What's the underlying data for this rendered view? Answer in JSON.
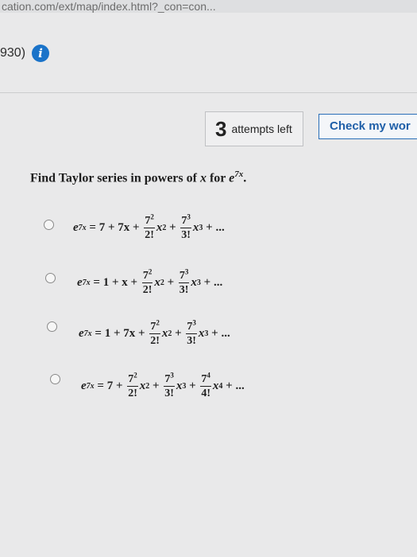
{
  "browser": {
    "url": "cation.com/ext/map/index.html?_con=con..."
  },
  "header": {
    "partial_text": "930)",
    "info_icon": "info-icon"
  },
  "toolbar": {
    "attempts_count": "3",
    "attempts_label": "attempts left",
    "check_label": "Check my wor"
  },
  "question": {
    "prefix": "Find Taylor series in powers of ",
    "var": "x",
    "mid": " for ",
    "base": "e",
    "exponent": "7x",
    "suffix": "."
  },
  "options": [
    {
      "lhs": "e",
      "lhs_exp": "7x",
      "eq": " = 7 + 7x + ",
      "terms": [
        {
          "num": "7",
          "num_exp": "2",
          "den": "2!",
          "x_exp": "2"
        },
        {
          "num": "7",
          "num_exp": "3",
          "den": "3!",
          "x_exp": "3"
        }
      ],
      "tail": " + ..."
    },
    {
      "lhs": "e",
      "lhs_exp": "7x",
      "eq": " = 1 + x + ",
      "terms": [
        {
          "num": "7",
          "num_exp": "2",
          "den": "2!",
          "x_exp": "2"
        },
        {
          "num": "7",
          "num_exp": "3",
          "den": "3!",
          "x_exp": "3"
        }
      ],
      "tail": " + ..."
    },
    {
      "lhs": "e",
      "lhs_exp": "7x",
      "eq": " = 1 + 7x + ",
      "terms": [
        {
          "num": "7",
          "num_exp": "2",
          "den": "2!",
          "x_exp": "2"
        },
        {
          "num": "7",
          "num_exp": "3",
          "den": "3!",
          "x_exp": "3"
        }
      ],
      "tail": " + ..."
    },
    {
      "lhs": "e",
      "lhs_exp": "7x",
      "eq": " = 7 + ",
      "terms": [
        {
          "num": "7",
          "num_exp": "2",
          "den": "2!",
          "x_exp": "2"
        },
        {
          "num": "7",
          "num_exp": "3",
          "den": "3!",
          "x_exp": "3"
        },
        {
          "num": "7",
          "num_exp": "4",
          "den": "4!",
          "x_exp": "4"
        }
      ],
      "tail": " + ..."
    }
  ],
  "colors": {
    "accent": "#1a73c9",
    "button_border": "#2a6fb8",
    "background": "#e9e9ea"
  }
}
